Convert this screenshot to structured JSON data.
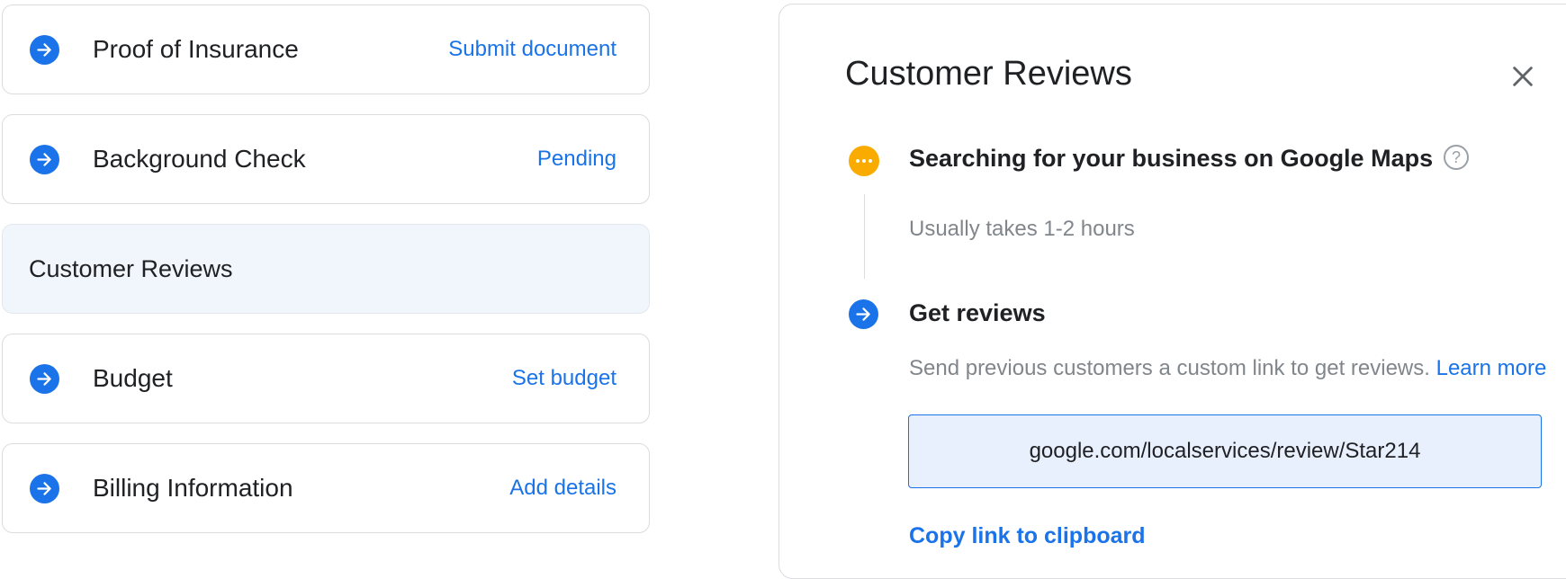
{
  "tasks": [
    {
      "label": "Proof of Insurance",
      "action": "Submit document",
      "icon": "arrow-right-circle-icon"
    },
    {
      "label": "Background Check",
      "action": "Pending",
      "icon": "arrow-right-circle-icon"
    },
    {
      "label": "Customer Reviews",
      "selected": true
    },
    {
      "label": "Budget",
      "action": "Set budget",
      "icon": "arrow-right-circle-icon"
    },
    {
      "label": "Billing Information",
      "action": "Add details",
      "icon": "arrow-right-circle-icon"
    }
  ],
  "panel": {
    "title": "Customer Reviews",
    "close_icon": "close-icon",
    "steps": [
      {
        "title": "Searching for your business on Google Maps",
        "subtitle": "Usually takes 1-2 hours",
        "status": "pending",
        "icon": "more-horizontal-icon",
        "help_icon": "help-icon",
        "help_glyph": "?"
      },
      {
        "title": "Get reviews",
        "description": "Send previous customers a custom link to get reviews.",
        "learn_more": "Learn more",
        "link": "google.com/localservices/review/Star214",
        "copy_label": "Copy link to clipboard",
        "icon": "arrow-right-circle-icon"
      }
    ]
  },
  "colors": {
    "accent": "#1a73e8",
    "pending": "#f9ab00",
    "selected_bg": "#f1f6fc",
    "link_box_bg": "#e8f0fe",
    "muted_text": "#80868b"
  }
}
